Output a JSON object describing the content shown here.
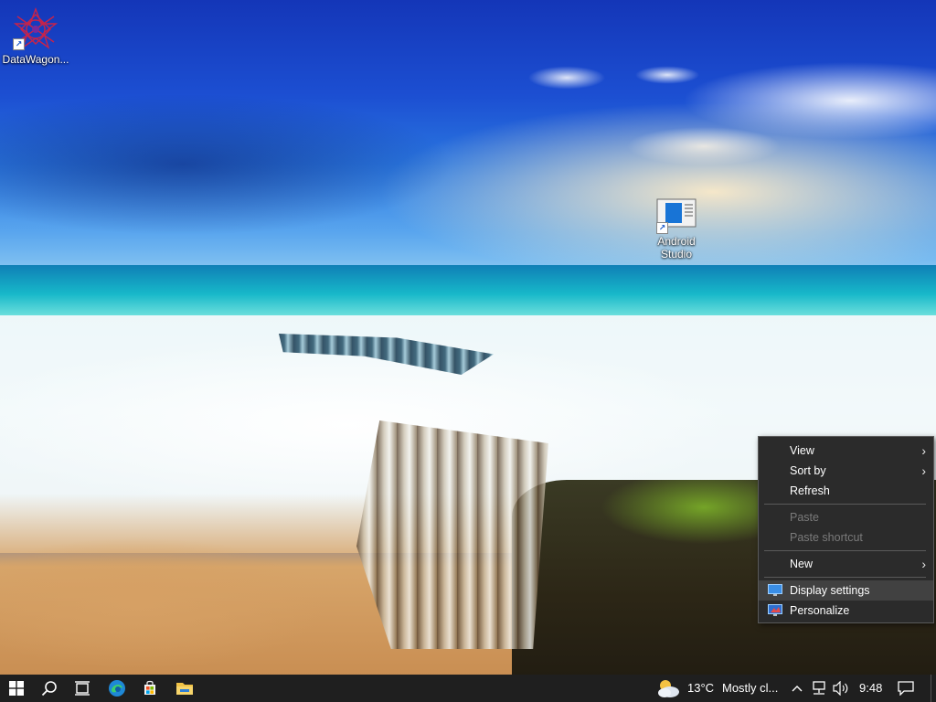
{
  "desktop": {
    "icons": [
      {
        "label": "DataWagon...",
        "icon": "datawagon-app-icon"
      },
      {
        "label": "Android Studio",
        "icon": "android-studio-icon"
      }
    ]
  },
  "context_menu": {
    "items": [
      {
        "label": "View",
        "submenu": true,
        "enabled": true
      },
      {
        "label": "Sort by",
        "submenu": true,
        "enabled": true
      },
      {
        "label": "Refresh",
        "submenu": false,
        "enabled": true
      },
      {
        "label": "Paste",
        "submenu": false,
        "enabled": false
      },
      {
        "label": "Paste shortcut",
        "submenu": false,
        "enabled": false
      },
      {
        "label": "New",
        "submenu": true,
        "enabled": true
      },
      {
        "label": "Display settings",
        "submenu": false,
        "enabled": true,
        "icon": "display-icon"
      },
      {
        "label": "Personalize",
        "submenu": false,
        "enabled": true,
        "icon": "personalize-icon"
      }
    ]
  },
  "taskbar": {
    "start": "windows-start-icon",
    "search": "search-icon",
    "task_view": "task-view-icon",
    "pinned": [
      "edge-icon",
      "store-icon",
      "file-explorer-icon"
    ],
    "weather": {
      "temp": "13°C",
      "condition": "Mostly cl..."
    },
    "time": "9:48",
    "tray_icons": [
      "chevron-up-icon",
      "network-icon",
      "volume-icon"
    ],
    "notification": "notification-icon"
  },
  "colors": {
    "taskbar_bg": "#1f1f1f",
    "menu_bg": "#2b2b2b",
    "menu_hover": "#414141",
    "menu_disabled_text": "#7a7a7a"
  }
}
